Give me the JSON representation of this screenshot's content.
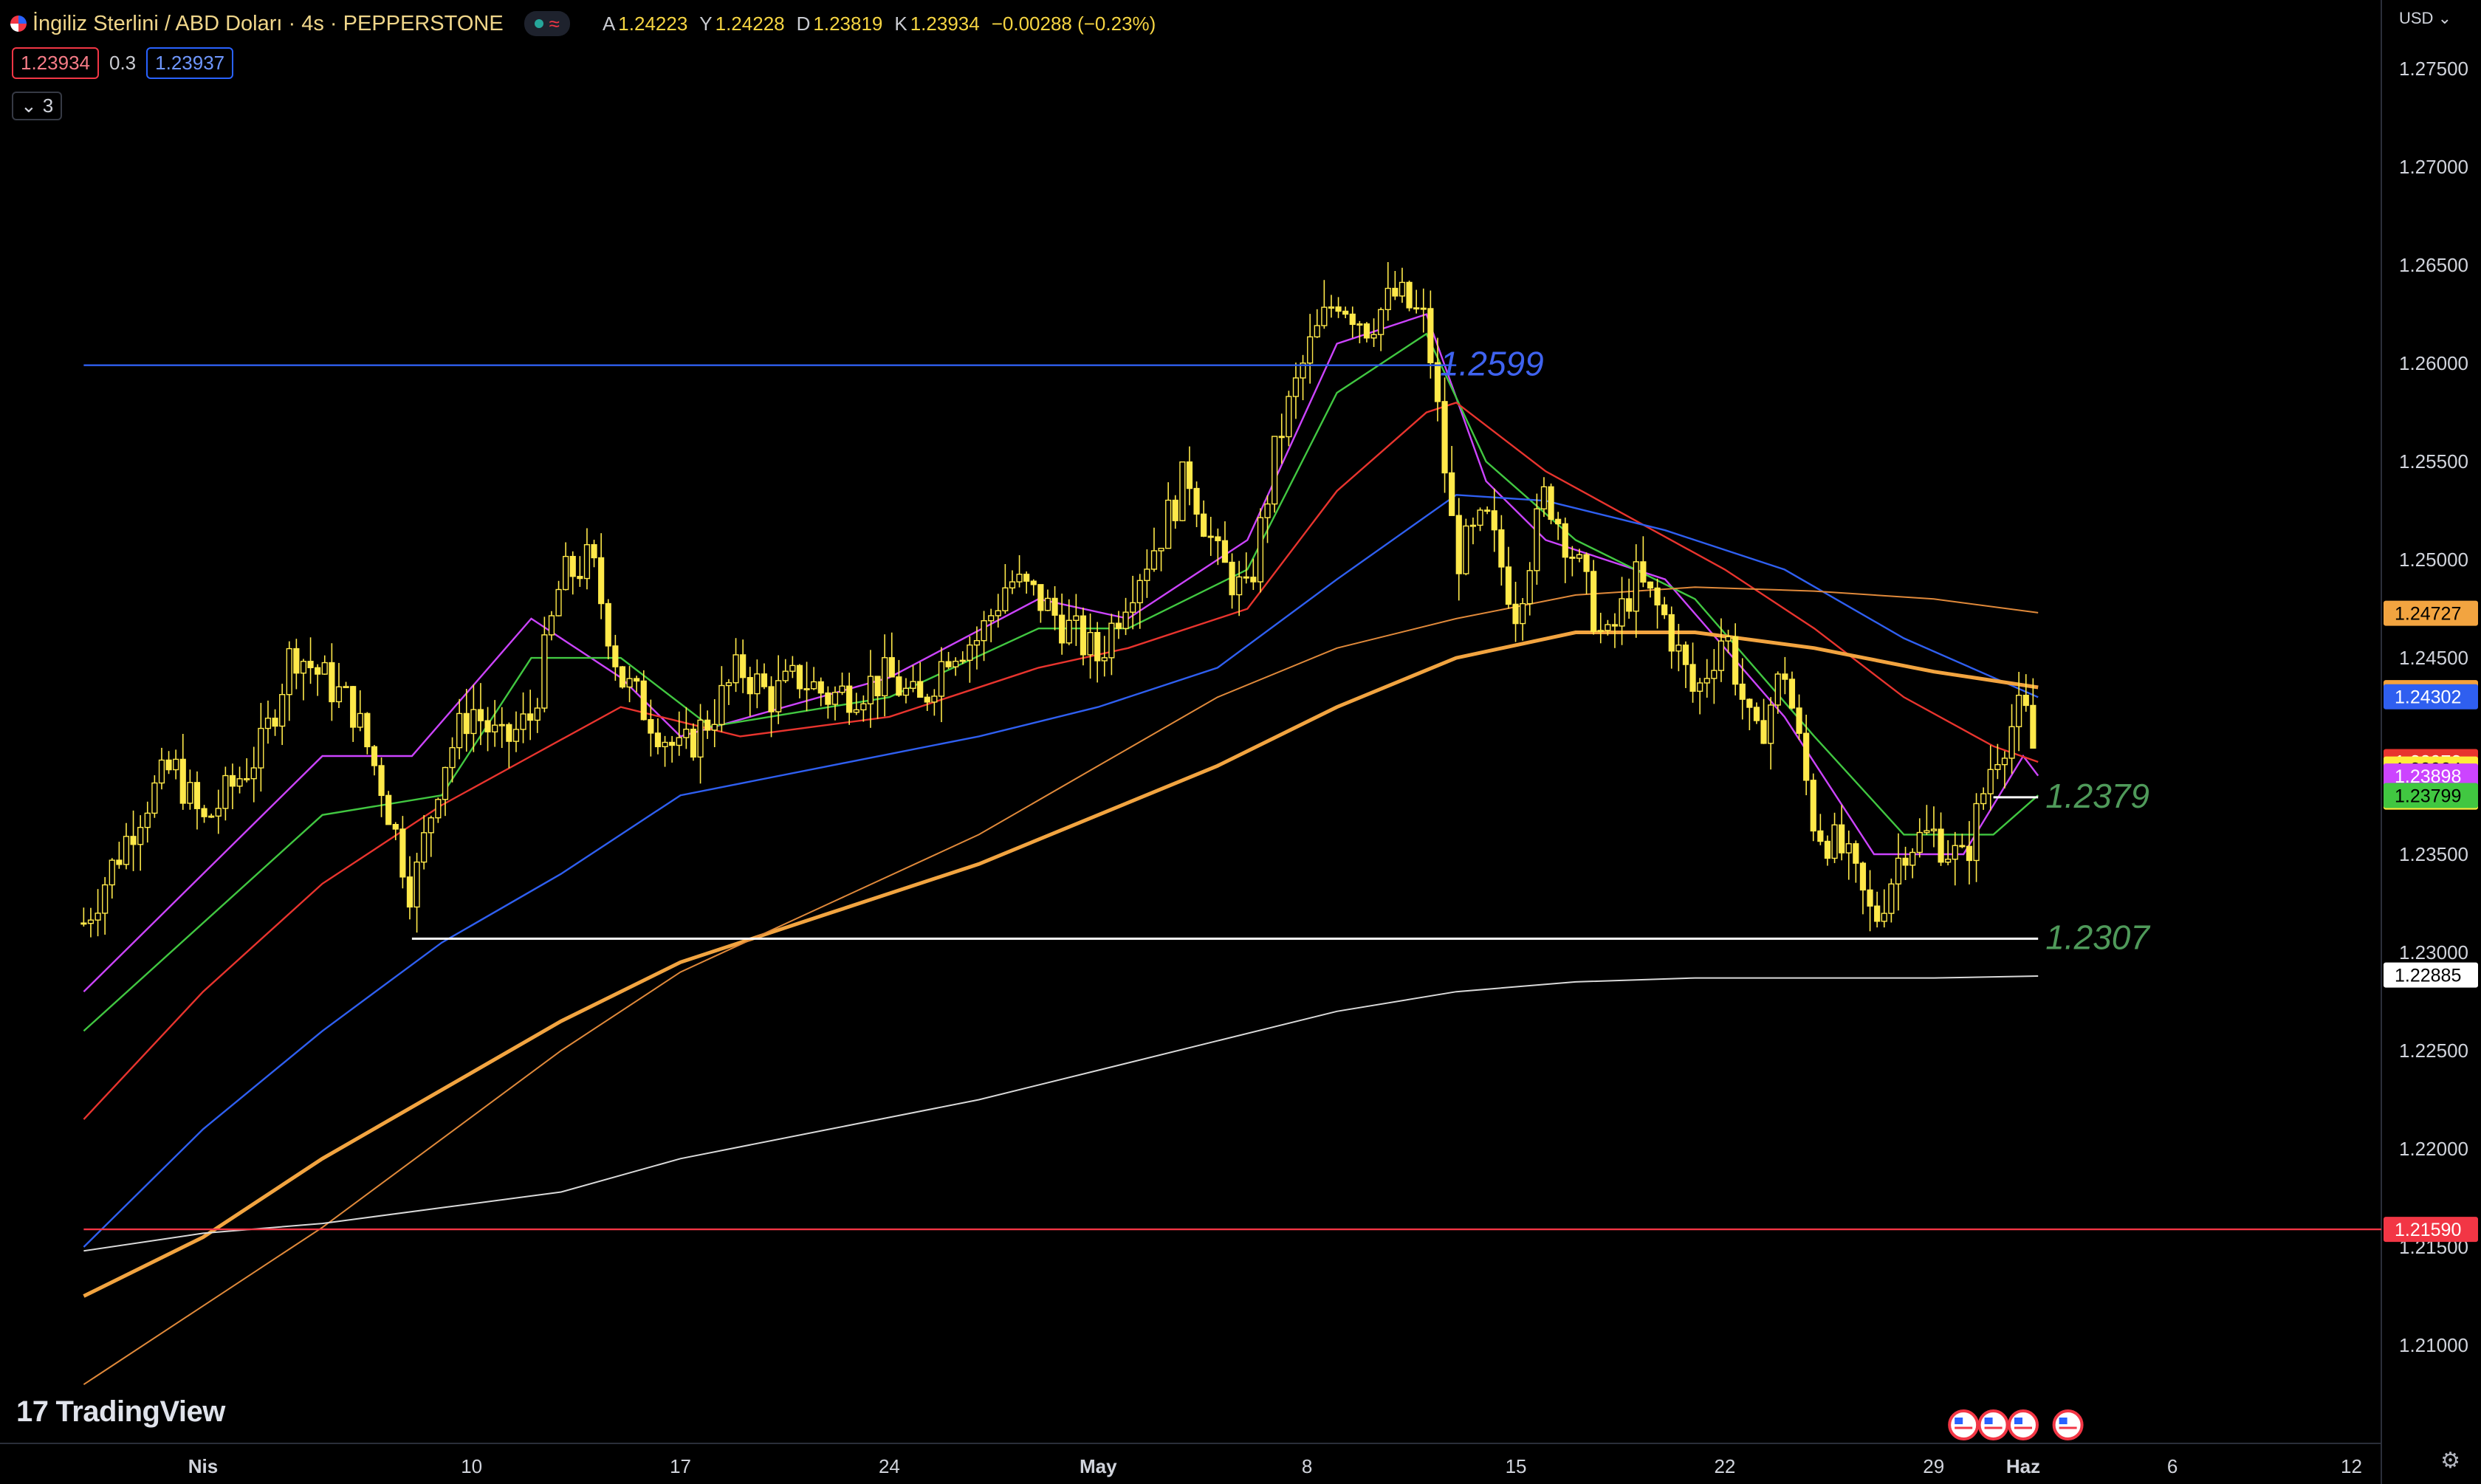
{
  "header": {
    "symbol": "İngiliz Sterlini / ABD Doları · 4s · PEPPERSTONE",
    "ohlc": [
      {
        "k": "A",
        "v": "1.24223"
      },
      {
        "k": "Y",
        "v": "1.24228"
      },
      {
        "k": "D",
        "v": "1.23819"
      },
      {
        "k": "K",
        "v": "1.23934"
      },
      {
        "k": "",
        "v": "−0.00288 (−0.23%)"
      }
    ],
    "bid": "1.23934",
    "spread": "0.3",
    "ask": "1.23937",
    "indicator_count": "3",
    "currency": "USD"
  },
  "branding": "TradingView",
  "chart_data": {
    "type": "candlestick",
    "ylim": [
      1.205,
      1.2785
    ],
    "y_ticks": [
      "1.27500",
      "1.27000",
      "1.26500",
      "1.26000",
      "1.25500",
      "1.25000",
      "1.24500",
      "1.24000",
      "1.23500",
      "1.23000",
      "1.22500",
      "1.22000",
      "1.21500",
      "1.21000"
    ],
    "x_ticks": [
      {
        "label": "Nis",
        "date": "2023-04-01",
        "bold": true
      },
      {
        "label": "10",
        "date": "2023-04-10"
      },
      {
        "label": "17",
        "date": "2023-04-17"
      },
      {
        "label": "24",
        "date": "2023-04-24"
      },
      {
        "label": "May",
        "date": "2023-05-01",
        "bold": true
      },
      {
        "label": "8",
        "date": "2023-05-08"
      },
      {
        "label": "15",
        "date": "2023-05-15"
      },
      {
        "label": "22",
        "date": "2023-05-22"
      },
      {
        "label": "29",
        "date": "2023-05-29"
      },
      {
        "label": "Haz",
        "date": "2023-06-01",
        "bold": true
      },
      {
        "label": "6",
        "date": "2023-06-06"
      },
      {
        "label": "12",
        "date": "2023-06-12"
      }
    ],
    "close_path": [
      [
        "2023-03-28",
        1.2315
      ],
      [
        "2023-03-29",
        1.2345
      ],
      [
        "2023-03-30",
        1.2375
      ],
      [
        "2023-03-31",
        1.2395
      ],
      [
        "2023-04-01",
        1.2365
      ],
      [
        "2023-04-03",
        1.2405
      ],
      [
        "2023-04-04",
        1.2455
      ],
      [
        "2023-04-05",
        1.244
      ],
      [
        "2023-04-06",
        1.2425
      ],
      [
        "2023-04-07",
        1.2385
      ],
      [
        "2023-04-08",
        1.233
      ],
      [
        "2023-04-09",
        1.2395
      ],
      [
        "2023-04-10",
        1.2425
      ],
      [
        "2023-04-11",
        1.2405
      ],
      [
        "2023-04-12",
        1.242
      ],
      [
        "2023-04-13",
        1.249
      ],
      [
        "2023-04-14",
        1.25
      ],
      [
        "2023-04-15",
        1.244
      ],
      [
        "2023-04-17",
        1.24
      ],
      [
        "2023-04-18",
        1.242
      ],
      [
        "2023-04-19",
        1.2445
      ],
      [
        "2023-04-20",
        1.243
      ],
      [
        "2023-04-21",
        1.244
      ],
      [
        "2023-04-22",
        1.243
      ],
      [
        "2023-04-24",
        1.244
      ],
      [
        "2023-04-25",
        1.2425
      ],
      [
        "2023-04-26",
        1.2455
      ],
      [
        "2023-04-27",
        1.246
      ],
      [
        "2023-04-28",
        1.249
      ],
      [
        "2023-04-29",
        1.248
      ],
      [
        "2023-05-01",
        1.245
      ],
      [
        "2023-05-02",
        1.2485
      ],
      [
        "2023-05-03",
        1.251
      ],
      [
        "2023-05-04",
        1.2545
      ],
      [
        "2023-05-05",
        1.25
      ],
      [
        "2023-05-06",
        1.248
      ],
      [
        "2023-05-07",
        1.256
      ],
      [
        "2023-05-08",
        1.2605
      ],
      [
        "2023-05-09",
        1.2635
      ],
      [
        "2023-05-10",
        1.262
      ],
      [
        "2023-05-11",
        1.2635
      ],
      [
        "2023-05-12",
        1.262
      ],
      [
        "2023-05-13",
        1.25
      ],
      [
        "2023-05-14",
        1.252
      ],
      [
        "2023-05-15",
        1.2475
      ],
      [
        "2023-05-16",
        1.2535
      ],
      [
        "2023-05-17",
        1.25
      ],
      [
        "2023-05-18",
        1.2455
      ],
      [
        "2023-05-19",
        1.249
      ],
      [
        "2023-05-20",
        1.247
      ],
      [
        "2023-05-21",
        1.243
      ],
      [
        "2023-05-22",
        1.2465
      ],
      [
        "2023-05-23",
        1.2405
      ],
      [
        "2023-05-24",
        1.2445
      ],
      [
        "2023-05-25",
        1.2365
      ],
      [
        "2023-05-26",
        1.235
      ],
      [
        "2023-05-27",
        1.2315
      ],
      [
        "2023-05-28",
        1.2355
      ],
      [
        "2023-05-29",
        1.236
      ],
      [
        "2023-05-30",
        1.2345
      ],
      [
        "2023-05-31",
        1.24
      ],
      [
        "2023-06-01",
        1.2425
      ],
      [
        "2023-06-01T12",
        1.2393
      ]
    ],
    "moving_averages": [
      {
        "color": "#cc44ff",
        "points": [
          [
            "2023-03-28",
            1.228
          ],
          [
            "2023-04-05",
            1.24
          ],
          [
            "2023-04-08",
            1.24
          ],
          [
            "2023-04-12",
            1.247
          ],
          [
            "2023-04-15",
            1.244
          ],
          [
            "2023-04-17",
            1.241
          ],
          [
            "2023-04-24",
            1.244
          ],
          [
            "2023-04-29",
            1.248
          ],
          [
            "2023-05-02",
            1.247
          ],
          [
            "2023-05-06",
            1.251
          ],
          [
            "2023-05-09",
            1.261
          ],
          [
            "2023-05-12",
            1.2625
          ],
          [
            "2023-05-14",
            1.254
          ],
          [
            "2023-05-16",
            1.251
          ],
          [
            "2023-05-20",
            1.249
          ],
          [
            "2023-05-24",
            1.242
          ],
          [
            "2023-05-27",
            1.235
          ],
          [
            "2023-05-30",
            1.235
          ],
          [
            "2023-06-01",
            1.24
          ],
          [
            "2023-06-01T12",
            1.239
          ]
        ]
      },
      {
        "color": "#41c741",
        "points": [
          [
            "2023-03-28",
            1.226
          ],
          [
            "2023-04-05",
            1.237
          ],
          [
            "2023-04-09",
            1.238
          ],
          [
            "2023-04-12",
            1.245
          ],
          [
            "2023-04-15",
            1.245
          ],
          [
            "2023-04-18",
            1.2415
          ],
          [
            "2023-04-24",
            1.243
          ],
          [
            "2023-04-29",
            1.2465
          ],
          [
            "2023-05-02",
            1.2465
          ],
          [
            "2023-05-06",
            1.2495
          ],
          [
            "2023-05-09",
            1.2585
          ],
          [
            "2023-05-12",
            1.2615
          ],
          [
            "2023-05-14",
            1.255
          ],
          [
            "2023-05-17",
            1.251
          ],
          [
            "2023-05-21",
            1.248
          ],
          [
            "2023-05-25",
            1.241
          ],
          [
            "2023-05-28",
            1.236
          ],
          [
            "2023-05-31",
            1.236
          ],
          [
            "2023-06-01T12",
            1.238
          ]
        ]
      },
      {
        "color": "#e8342e",
        "points": [
          [
            "2023-03-28",
            1.2215
          ],
          [
            "2023-04-01",
            1.228
          ],
          [
            "2023-04-05",
            1.2335
          ],
          [
            "2023-04-09",
            1.2375
          ],
          [
            "2023-04-12",
            1.24
          ],
          [
            "2023-04-15",
            1.2425
          ],
          [
            "2023-04-19",
            1.241
          ],
          [
            "2023-04-24",
            1.242
          ],
          [
            "2023-04-29",
            1.2445
          ],
          [
            "2023-05-02",
            1.2455
          ],
          [
            "2023-05-06",
            1.2475
          ],
          [
            "2023-05-09",
            1.2535
          ],
          [
            "2023-05-12",
            1.2575
          ],
          [
            "2023-05-13",
            1.258
          ],
          [
            "2023-05-16",
            1.2545
          ],
          [
            "2023-05-19",
            1.252
          ],
          [
            "2023-05-22",
            1.2495
          ],
          [
            "2023-05-25",
            1.2465
          ],
          [
            "2023-05-28",
            1.243
          ],
          [
            "2023-05-31",
            1.2405
          ],
          [
            "2023-06-01T12",
            1.2397
          ]
        ]
      },
      {
        "color": "#2f5ff0",
        "points": [
          [
            "2023-03-28",
            1.215
          ],
          [
            "2023-04-01",
            1.221
          ],
          [
            "2023-04-05",
            1.226
          ],
          [
            "2023-04-09",
            1.2305
          ],
          [
            "2023-04-13",
            1.234
          ],
          [
            "2023-04-17",
            1.238
          ],
          [
            "2023-04-22",
            1.2395
          ],
          [
            "2023-04-27",
            1.241
          ],
          [
            "2023-05-01",
            1.2425
          ],
          [
            "2023-05-05",
            1.2445
          ],
          [
            "2023-05-09",
            1.249
          ],
          [
            "2023-05-13",
            1.2533
          ],
          [
            "2023-05-16",
            1.253
          ],
          [
            "2023-05-20",
            1.2515
          ],
          [
            "2023-05-24",
            1.2495
          ],
          [
            "2023-05-28",
            1.246
          ],
          [
            "2023-05-31",
            1.244
          ],
          [
            "2023-06-01T12",
            1.243
          ]
        ]
      },
      {
        "color": "#f2a440",
        "width": 5,
        "points": [
          [
            "2023-03-28",
            1.2125
          ],
          [
            "2023-04-01",
            1.2155
          ],
          [
            "2023-04-05",
            1.2195
          ],
          [
            "2023-04-09",
            1.223
          ],
          [
            "2023-04-13",
            1.2265
          ],
          [
            "2023-04-17",
            1.2295
          ],
          [
            "2023-04-22",
            1.232
          ],
          [
            "2023-04-27",
            1.2345
          ],
          [
            "2023-05-01",
            1.237
          ],
          [
            "2023-05-05",
            1.2395
          ],
          [
            "2023-05-09",
            1.2425
          ],
          [
            "2023-05-13",
            1.245
          ],
          [
            "2023-05-17",
            1.2463
          ],
          [
            "2023-05-21",
            1.2463
          ],
          [
            "2023-05-25",
            1.2455
          ],
          [
            "2023-05-29",
            1.2443
          ],
          [
            "2023-06-01T12",
            1.2435
          ]
        ]
      },
      {
        "color": "#e0893a",
        "width": 2,
        "points": [
          [
            "2023-03-28",
            1.208
          ],
          [
            "2023-04-01",
            1.212
          ],
          [
            "2023-04-05",
            1.216
          ],
          [
            "2023-04-09",
            1.2205
          ],
          [
            "2023-04-13",
            1.225
          ],
          [
            "2023-04-17",
            1.229
          ],
          [
            "2023-04-22",
            1.2325
          ],
          [
            "2023-04-27",
            1.236
          ],
          [
            "2023-05-01",
            1.2395
          ],
          [
            "2023-05-05",
            1.243
          ],
          [
            "2023-05-09",
            1.2455
          ],
          [
            "2023-05-13",
            1.247
          ],
          [
            "2023-05-17",
            1.2482
          ],
          [
            "2023-05-21",
            1.2486
          ],
          [
            "2023-05-25",
            1.2484
          ],
          [
            "2023-05-29",
            1.248
          ],
          [
            "2023-06-01T12",
            1.2473
          ]
        ]
      },
      {
        "color": "#d9d9d9",
        "width": 2,
        "points": [
          [
            "2023-03-28",
            1.2148
          ],
          [
            "2023-04-01",
            1.2157
          ],
          [
            "2023-04-05",
            1.2162
          ],
          [
            "2023-04-09",
            1.217
          ],
          [
            "2023-04-13",
            1.2178
          ],
          [
            "2023-04-17",
            1.2195
          ],
          [
            "2023-04-22",
            1.221
          ],
          [
            "2023-04-27",
            1.2225
          ],
          [
            "2023-05-01",
            1.224
          ],
          [
            "2023-05-05",
            1.2255
          ],
          [
            "2023-05-09",
            1.227
          ],
          [
            "2023-05-13",
            1.228
          ],
          [
            "2023-05-17",
            1.2285
          ],
          [
            "2023-05-21",
            1.2287
          ],
          [
            "2023-05-25",
            1.2287
          ],
          [
            "2023-05-29",
            1.2287
          ],
          [
            "2023-06-01T12",
            1.2288
          ]
        ]
      }
    ],
    "horizontal_lines": [
      {
        "price": 1.2599,
        "color": "#2f5ff0",
        "x_from": "2023-03-28",
        "x_to": "2023-05-13",
        "label": "1.2599",
        "label_color": "#3f63f0"
      },
      {
        "price": 1.2307,
        "color": "#ffffff",
        "x_from": "2023-04-08",
        "x_to": "2023-06-01T12",
        "label": "1.2307",
        "label_color": "#4f9a5a"
      },
      {
        "price": 1.2379,
        "color": "#ffffff",
        "x_from": "2023-05-31",
        "x_to": "2023-06-01T12",
        "label": "1.2379",
        "label_color": "#4f9a5a"
      },
      {
        "price": 1.2159,
        "color": "#f23645",
        "x_from": "2023-03-28",
        "x_to": "2023-06-14"
      }
    ],
    "price_labels": [
      {
        "price": 1.24727,
        "text": "1.24727",
        "bg": "#f2a440",
        "fg": "#000"
      },
      {
        "price": 1.24323,
        "text": "1.24323",
        "bg": "#f7a23a",
        "fg": "#000"
      },
      {
        "price": 1.24302,
        "text": "1.24302",
        "bg": "#2f5ff0",
        "fg": "#fff"
      },
      {
        "price": 1.23972,
        "text": "1.23972",
        "bg": "#e8342e",
        "fg": "#fff"
      },
      {
        "price": 1.23934,
        "text": "1.23934",
        "sub": "02:01",
        "bg": "#ffeb3b",
        "fg": "#000"
      },
      {
        "price": 1.23898,
        "text": "1.23898",
        "bg": "#cc44ff",
        "fg": "#fff"
      },
      {
        "price": 1.23799,
        "text": "1.23799",
        "bg": "#41c741",
        "fg": "#000"
      },
      {
        "price": 1.22885,
        "text": "1.22885",
        "bg": "#ffffff",
        "fg": "#000"
      },
      {
        "price": 1.2159,
        "text": "1.21590",
        "bg": "#f23645",
        "fg": "#fff"
      }
    ],
    "event_markers": [
      "2023-05-30",
      "2023-05-31",
      "2023-06-01",
      "2023-06-02T12"
    ],
    "grid": false
  }
}
